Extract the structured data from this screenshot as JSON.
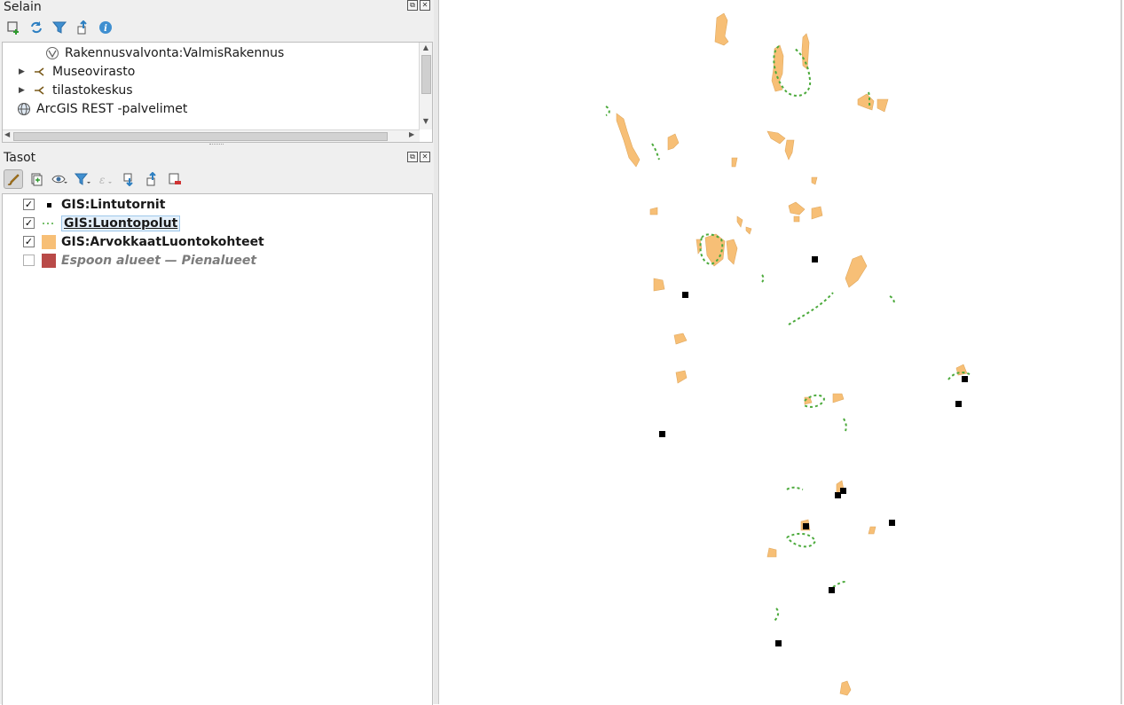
{
  "browser_panel": {
    "title": "Selain",
    "toolbar": [
      "add-layer-icon",
      "refresh-icon",
      "filter-icon",
      "collapse-all-icon",
      "properties-icon"
    ],
    "items": [
      {
        "label": "Rakennusvalvonta:ValmisRakennus",
        "icon": "wfs-layer-icon",
        "indent": 2,
        "expandable": false
      },
      {
        "label": "Museovirasto",
        "icon": "connection-icon",
        "indent": 1,
        "expandable": true
      },
      {
        "label": "tilastokeskus",
        "icon": "connection-icon",
        "indent": 1,
        "expandable": true
      },
      {
        "label": "ArcGIS REST -palvelimet",
        "icon": "globe-icon",
        "indent": 0,
        "expandable": false
      }
    ]
  },
  "layers_panel": {
    "title": "Tasot",
    "toolbar": [
      "style-icon",
      "add-group-icon",
      "visibility-icon",
      "filter-legend-icon",
      "expression-filter-icon",
      "expand-all-icon",
      "collapse-all-icon",
      "remove-layer-icon"
    ],
    "layers": [
      {
        "name": "GIS:Lintutornit",
        "checked": true,
        "symbol": "point",
        "symbol_color": "#000000",
        "selected": false,
        "disabled": false
      },
      {
        "name": "GIS:Luontopolut",
        "checked": true,
        "symbol": "dashed-line",
        "symbol_color": "#4caa3c",
        "selected": true,
        "disabled": false
      },
      {
        "name": "GIS:ArvokkaatLuontokohteet",
        "checked": true,
        "symbol": "polygon",
        "symbol_color": "#f7bf76",
        "selected": false,
        "disabled": false
      },
      {
        "name": "Espoon alueet — Pienalueet",
        "checked": false,
        "symbol": "polygon",
        "symbol_color": "#b94a48",
        "selected": false,
        "disabled": true
      }
    ]
  },
  "map": {
    "background": "#ffffff",
    "polygon_fill": "#f7bf76",
    "polygon_stroke": "#e0a85e",
    "trail_color": "#4caa3c",
    "tower_color": "#000000"
  }
}
